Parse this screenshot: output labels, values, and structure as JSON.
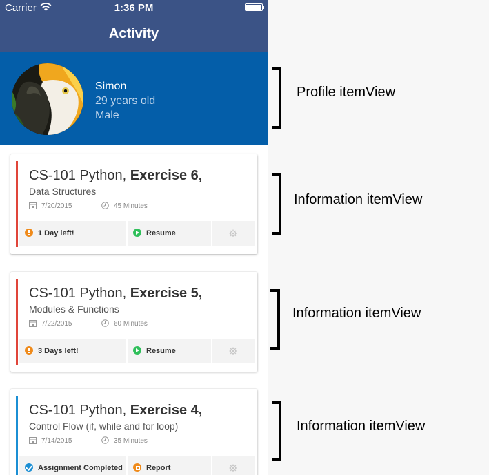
{
  "status_bar": {
    "carrier": "Carrier",
    "time": "1:36 PM"
  },
  "nav": {
    "title": "Activity"
  },
  "profile": {
    "name": "Simon",
    "age": "29 years old",
    "gender": "Male"
  },
  "cards": [
    {
      "title_prefix": "CS-101 Python,",
      "title_bold": "Exercise 6,",
      "subtitle": "Data Structures",
      "date": "7/20/2015",
      "duration": "45 Minutes",
      "stripe_color": "#e0453a",
      "status_label": "1 Day left!",
      "status_icon": "warning-icon",
      "action_label": "Resume",
      "action_icon": "play-icon"
    },
    {
      "title_prefix": "CS-101 Python,",
      "title_bold": "Exercise 5,",
      "subtitle": "Modules & Functions",
      "date": "7/22/2015",
      "duration": "60 Minutes",
      "stripe_color": "#e0453a",
      "status_label": "3 Days left!",
      "status_icon": "warning-icon",
      "action_label": "Resume",
      "action_icon": "play-icon"
    },
    {
      "title_prefix": "CS-101 Python,",
      "title_bold": "Exercise 4,",
      "subtitle": "Control Flow (if, while and for loop)",
      "date": "7/14/2015",
      "duration": "35 Minutes",
      "stripe_color": "#1b8fd4",
      "status_label": "Assignment Completed",
      "status_icon": "check-icon",
      "action_label": "Report",
      "action_icon": "report-icon"
    }
  ],
  "annotations": {
    "profile": "Profile itemView",
    "info1": "Information itemView",
    "info2": "Information itemView",
    "info3": "Information itemView"
  },
  "colors": {
    "navbar": "#3b5386",
    "profile_bg": "#045ea9",
    "warning": "#ef8a1a",
    "resume": "#2fbf5a",
    "completed": "#1b8fd4"
  }
}
